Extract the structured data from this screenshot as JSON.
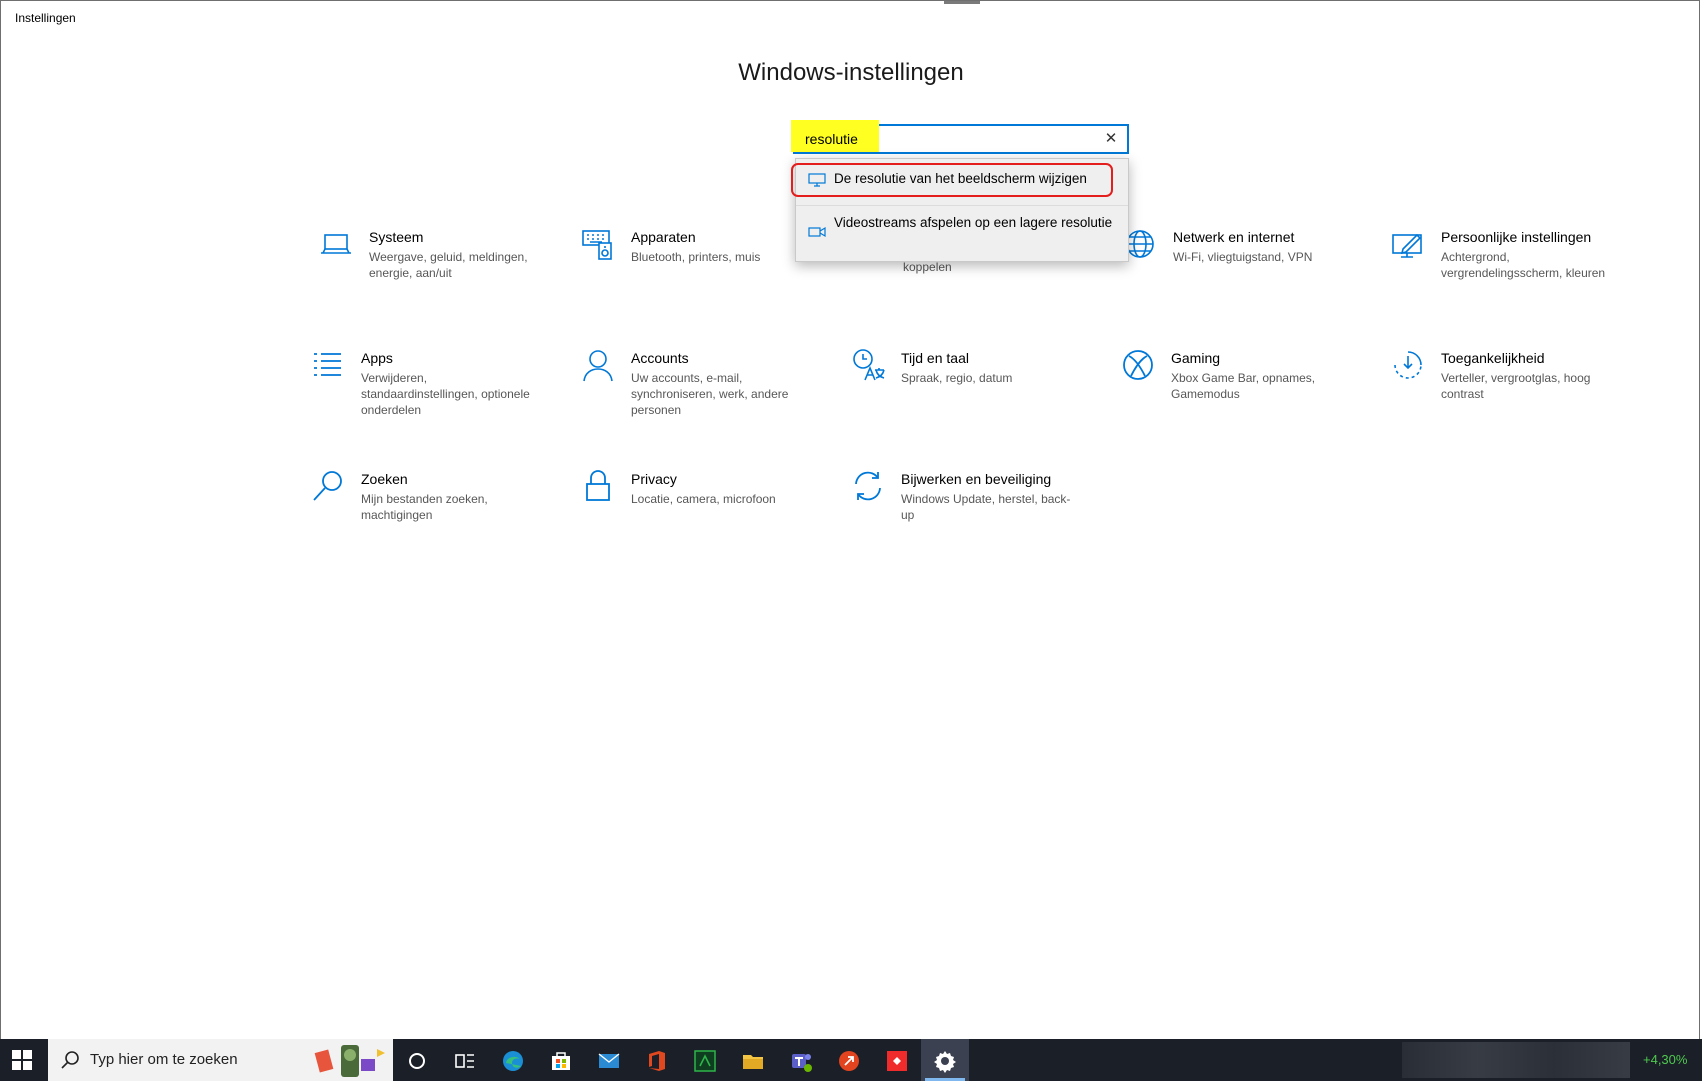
{
  "window": {
    "title": "Instellingen"
  },
  "page_title": "Windows-instellingen",
  "search": {
    "value": "resolutie",
    "clear_icon": "close-icon"
  },
  "suggestions": [
    {
      "label": "De resolutie van het beeldscherm wijzigen",
      "icon": "monitor-icon"
    },
    {
      "label": "Videostreams afspelen op een lagere resolutie",
      "icon": "video-icon"
    }
  ],
  "categories": [
    {
      "name": "Systeem",
      "desc": "Weergave, geluid, meldingen, energie, aan/uit",
      "icon": "laptop-icon"
    },
    {
      "name": "Apparaten",
      "desc": "Bluetooth, printers, muis",
      "icon": "devices-icon"
    },
    {
      "name": "",
      "desc": "koppelen",
      "icon": "phone-icon"
    },
    {
      "name": "Netwerk en internet",
      "desc": "Wi-Fi, vliegtuigstand, VPN",
      "icon": "globe-icon"
    },
    {
      "name": "Persoonlijke instellingen",
      "desc": "Achtergrond, vergrendelingsscherm, kleuren",
      "icon": "personalize-icon"
    },
    {
      "name": "Apps",
      "desc": "Verwijderen, standaardinstellingen, optionele onderdelen",
      "icon": "apps-list-icon"
    },
    {
      "name": "Accounts",
      "desc": "Uw accounts, e-mail, synchroniseren, werk, andere personen",
      "icon": "person-icon"
    },
    {
      "name": "Tijd en taal",
      "desc": "Spraak, regio, datum",
      "icon": "time-language-icon"
    },
    {
      "name": "Gaming",
      "desc": "Xbox Game Bar, opnames, Gamemodus",
      "icon": "xbox-icon"
    },
    {
      "name": "Toegankelijkheid",
      "desc": "Verteller, vergrootglas, hoog contrast",
      "icon": "accessibility-icon"
    },
    {
      "name": "Zoeken",
      "desc": "Mijn bestanden zoeken, machtigingen",
      "icon": "search-icon"
    },
    {
      "name": "Privacy",
      "desc": "Locatie, camera, microfoon",
      "icon": "lock-icon"
    },
    {
      "name": "Bijwerken en beveiliging",
      "desc": "Windows Update, herstel, back-up",
      "icon": "sync-icon"
    }
  ],
  "taskbar": {
    "search_placeholder": "Typ hier om te zoeken",
    "stock_change": "+4,30%"
  },
  "colors": {
    "accent": "#0078d7",
    "highlight": "#ffff22",
    "annotation": "#e41d1d",
    "taskbar": "#1b1f27"
  }
}
